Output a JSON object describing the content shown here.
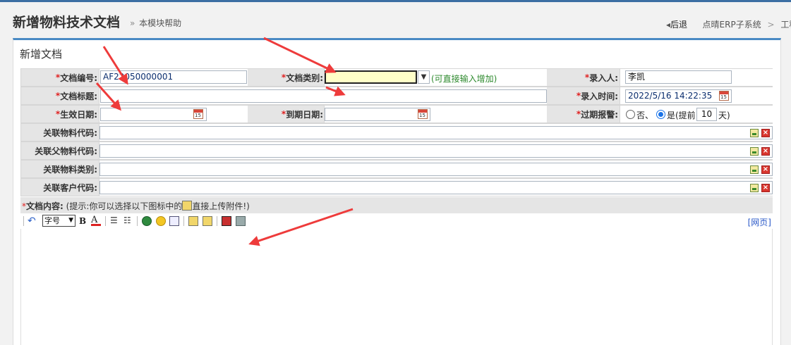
{
  "page": {
    "title": "新增物料技术文档",
    "help_link": "本模块帮助",
    "help_arrow": "»"
  },
  "breadcrumb": {
    "back_label": "后退",
    "items": [
      "点晴ERP子系统",
      "工程管"
    ],
    "separator": ">"
  },
  "panel": {
    "title": "新增文档"
  },
  "form": {
    "required_mark": "*",
    "doc_no": {
      "label": "文档编号:",
      "value": "AF22050000001"
    },
    "doc_type": {
      "label": "文档类别:",
      "value": "",
      "hint": "(可直接输入增加)"
    },
    "recorder": {
      "label": "录入人:",
      "value": "李凯"
    },
    "doc_title": {
      "label": "文档标题:",
      "value": ""
    },
    "record_time": {
      "label": "录入时间:",
      "value": "2022/5/16 14:22:35"
    },
    "effective_date": {
      "label": "生效日期:",
      "value": ""
    },
    "expiry_date": {
      "label": "到期日期:",
      "value": ""
    },
    "expiry_alert": {
      "label": "过期报警:",
      "option_no": "否、",
      "option_yes": "是(提前",
      "days_value": "10",
      "days_unit": "天)",
      "selected": "yes"
    },
    "material_code": {
      "label": "关联物料代码:",
      "value": ""
    },
    "parent_material_code": {
      "label": "关联父物料代码:",
      "value": ""
    },
    "material_category": {
      "label": "关联物料类别:",
      "value": ""
    },
    "customer_code": {
      "label": "关联客户代码:",
      "value": ""
    },
    "content_note": {
      "label": "文档内容:",
      "hint_prefix": "(提示:你可以选择以下图标中的",
      "hint_suffix": "直接上传附件!)"
    }
  },
  "editor": {
    "font_size_label": "字号",
    "html_mode_label": "[网页]",
    "content": ""
  },
  "icons": {
    "calendar_day": "15",
    "delete_mark": "×"
  },
  "colors": {
    "accent": "#4a8ac4",
    "required": "#e02020",
    "hint_green": "#2e8a2e",
    "focused_field": "#ffffc8",
    "annotation_arrow": "#ee3b3b"
  }
}
